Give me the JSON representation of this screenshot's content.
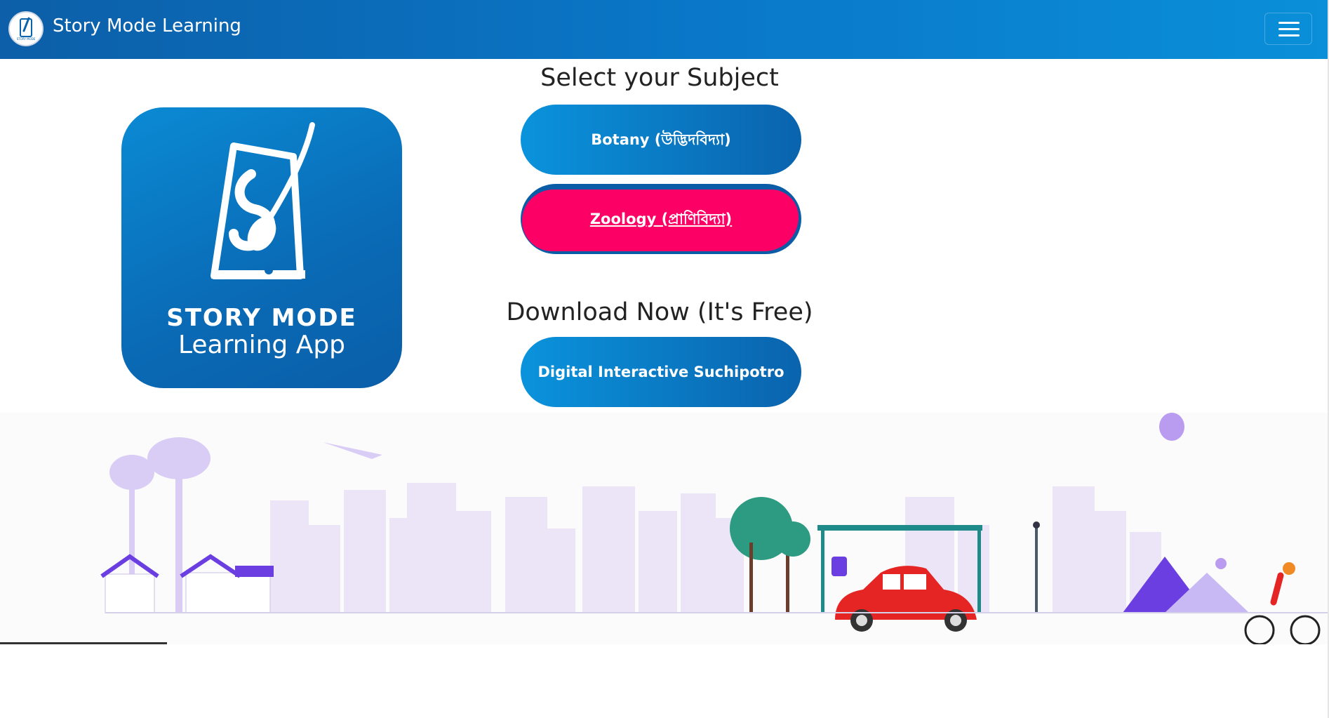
{
  "navbar": {
    "title": "Story Mode Learning",
    "menu_icon": "hamburger-menu-icon"
  },
  "app_card": {
    "line1": "STORY MODE",
    "line2": "Learning App"
  },
  "main": {
    "subject_heading": "Select your Subject",
    "subjects": [
      {
        "label": "Botany (উদ্ভিদবিদ্যা)"
      },
      {
        "label": "Zoology (প্রাণিবিদ্যা)"
      }
    ],
    "download_heading": "Download Now (It's Free)",
    "download_button": "Digital Interactive Suchipotro"
  },
  "colors": {
    "nav": "#0a78c9",
    "button": "#0a63ad",
    "zoology_highlight": "#fd0066",
    "scene_building": "#ebe5f7",
    "car": "#e52523"
  }
}
